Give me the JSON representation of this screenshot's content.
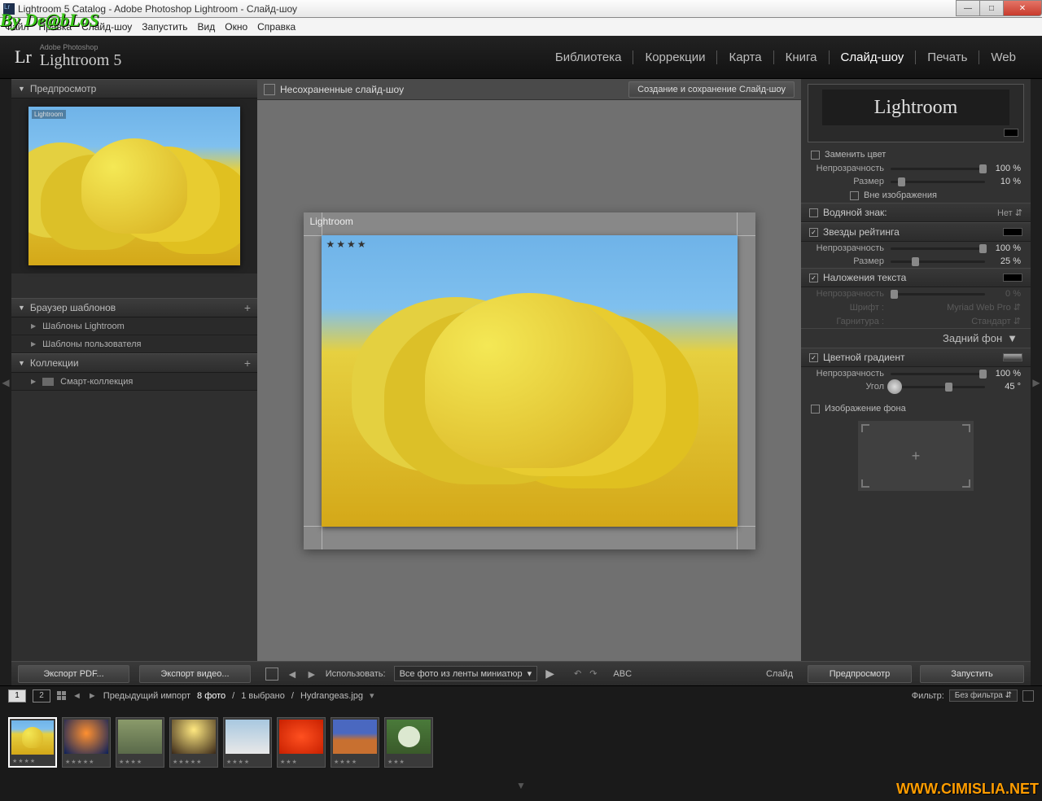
{
  "titlebar": {
    "title": "Lightroom 5 Catalog - Adobe Photoshop Lightroom - Слайд-шоу"
  },
  "watermark": "By De@bLoS",
  "watermark_url": "WWW.CIMISLIA.NET",
  "menubar": [
    "Файл",
    "Правка",
    "Слайд-шоу",
    "Запустить",
    "Вид",
    "Окно",
    "Справка"
  ],
  "logo": {
    "small": "Adobe Photoshop",
    "name": "Lightroom 5"
  },
  "modules": [
    {
      "label": "Библиотека",
      "active": false
    },
    {
      "label": "Коррекции",
      "active": false
    },
    {
      "label": "Карта",
      "active": false
    },
    {
      "label": "Книга",
      "active": false
    },
    {
      "label": "Слайд-шоу",
      "active": true
    },
    {
      "label": "Печать",
      "active": false
    },
    {
      "label": "Web",
      "active": false
    }
  ],
  "left": {
    "preview_header": "Предпросмотр",
    "preview_wm": "Lightroom",
    "templates_header": "Браузер шаблонов",
    "template_items": [
      "Шаблоны Lightroom",
      "Шаблоны пользователя"
    ],
    "collections_header": "Коллекции",
    "collection_items": [
      "Смарт-коллекция"
    ],
    "export_pdf": "Экспорт PDF...",
    "export_video": "Экспорт видео..."
  },
  "center": {
    "header_title": "Несохраненные слайд-шоу",
    "save_btn": "Создание и сохранение Слайд-шоу",
    "slide_wm": "Lightroom",
    "slide_stars": "★★★★",
    "use_label": "Использовать:",
    "use_value": "Все фото из ленты миниатюр",
    "abc": "ABC",
    "slide_label": "Слайд"
  },
  "right": {
    "identity_text": "Lightroom",
    "override_color": "Заменить цвет",
    "opacity_label": "Непрозрачность",
    "size_label": "Размер",
    "angle_label": "Угол",
    "outside_image": "Вне изображения",
    "watermark_header": "Водяной знак:",
    "watermark_value": "Нет",
    "rating_header": "Звезды рейтинга",
    "rating_opacity_val": "100 %",
    "rating_size_val": "25 %",
    "text_header": "Наложения текста",
    "text_opacity_val": "0  %",
    "font_label": "Шрифт :",
    "font_value": "Myriad Web Pro",
    "face_label": "Гарнитура :",
    "face_value": "Стандарт",
    "bg_title": "Задний фон",
    "gradient_header": "Цветной градиент",
    "gradient_opacity": "100 %",
    "gradient_angle": "45 °",
    "bg_image_header": "Изображение фона",
    "ident_opacity": "100 %",
    "ident_size": "10 %",
    "preview_btn": "Предпросмотр",
    "play_btn": "Запустить"
  },
  "filmstrip_bar": {
    "path": "Предыдущий импорт",
    "count": "8 фото",
    "selected": "1 выбрано",
    "filename": "Hydrangeas.jpg",
    "filter_label": "Фильтр:",
    "filter_value": "Без фильтра"
  },
  "thumbs": [
    {
      "stars": "★★★★",
      "cls": "tulips",
      "active": true
    },
    {
      "stars": "★★★★★",
      "cls": "bg-jelly"
    },
    {
      "stars": "★★★★",
      "cls": "bg-koala"
    },
    {
      "stars": "★★★★★",
      "cls": "bg-light"
    },
    {
      "stars": "★★★★",
      "cls": "bg-peng"
    },
    {
      "stars": "★★★",
      "cls": "bg-flower"
    },
    {
      "stars": "★★★★",
      "cls": "bg-desert"
    },
    {
      "stars": "★★★",
      "cls": "bg-hydra"
    }
  ]
}
